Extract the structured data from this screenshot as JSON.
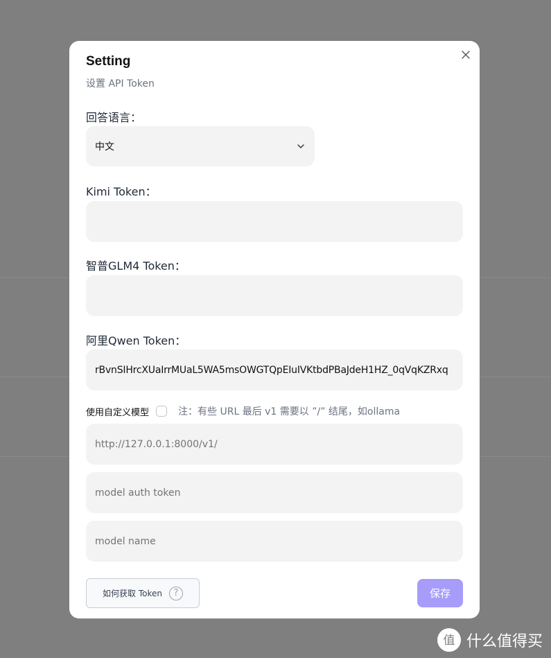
{
  "dialog": {
    "title": "Setting",
    "subtitle": "设置 API Token"
  },
  "language": {
    "label": "回答语言：",
    "selected": "中文"
  },
  "kimi": {
    "label": "Kimi Token：",
    "value": ""
  },
  "glm": {
    "label": "智普GLM4 Token：",
    "value": ""
  },
  "qwen": {
    "label": "阿里Qwen Token：",
    "value": "rBvnSIHrcXUaIrrMUaL5WA5msOWGTQpEIuIVKtbdPBaJdeH1HZ_0qVqKZRxq"
  },
  "custom_model": {
    "label": "使用自定义模型",
    "checked": false,
    "note": "注：有些 URL 最后 v1 需要以 ”/” 结尾，如ollama",
    "url_placeholder": "http://127.0.0.1:8000/v1/",
    "token_placeholder": "model auth token",
    "name_placeholder": "model name"
  },
  "footer": {
    "help_label": "如何获取 Token",
    "help_icon": "?",
    "save_label": "保存"
  },
  "colors": {
    "accent": "#a89cfb",
    "field_bg": "#f3f3f3",
    "overlay": "#7f7f7f"
  },
  "watermark": {
    "logo_text": "值",
    "text": "什么值得买"
  }
}
